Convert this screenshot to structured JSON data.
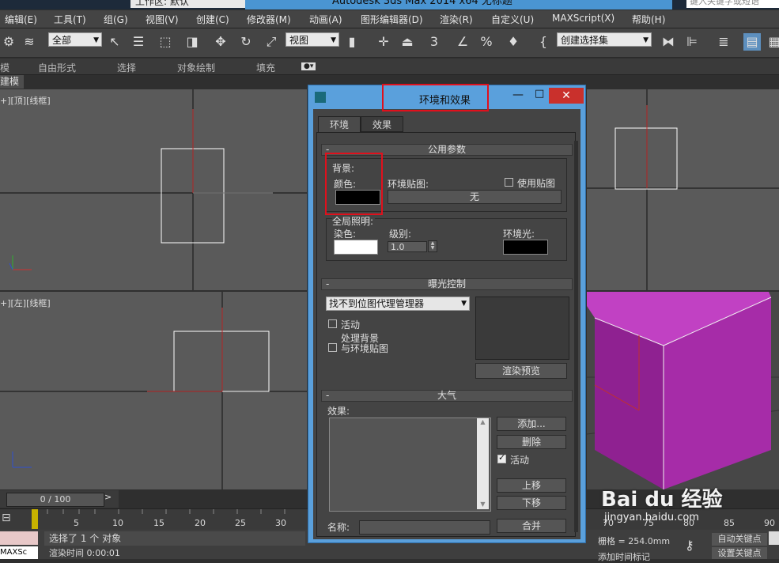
{
  "window": {
    "workspace": "工作区: 默认",
    "title": "Autodesk 3ds Max  2014 x64      无标题",
    "search_placeholder": "键入关键字或短语"
  },
  "menubar": [
    "编辑(E)",
    "工具(T)",
    "组(G)",
    "视图(V)",
    "创建(C)",
    "修改器(M)",
    "动画(A)",
    "图形编辑器(D)",
    "渲染(R)",
    "自定义(U)",
    "MAXScript(X)",
    "帮助(H)"
  ],
  "toolbar": {
    "selection_filter": "全部",
    "ref_coord": "视图",
    "named_selection": "创建选择集",
    "snap_3": "3",
    "percent": "%"
  },
  "ribbon": {
    "tabs": [
      "模",
      "自由形式",
      "选择",
      "对象绘制",
      "填充"
    ],
    "sub": "建模"
  },
  "viewports": {
    "top_label": "+][顶][线框]",
    "left_label": "+][左][线框]"
  },
  "timeline": {
    "frame": "0 / 100",
    "ticks": [
      "5",
      "10",
      "15",
      "20",
      "25",
      "30",
      "70",
      "75",
      "80",
      "85",
      "90"
    ]
  },
  "status": {
    "selected": "选择了 1 个 对象",
    "render_time": "渲染时间 0:00:01",
    "maxscript": "MAXSc",
    "grid": "栅格 = 254.0mm",
    "auto_key": "自动关键点",
    "set_key": "设置关键点",
    "add_time_tag": "添加时间标记"
  },
  "dialog": {
    "title": "环境和效果",
    "tabs": [
      "环境",
      "效果"
    ],
    "common": {
      "header": "公用参数",
      "background_label": "背景:",
      "color_label": "颜色:",
      "env_map_label": "环境贴图:",
      "use_map_label": "使用贴图",
      "env_map_button": "无",
      "global_light_label": "全局照明:",
      "tint_label": "染色:",
      "level_label": "级别:",
      "level_value": "1.0",
      "ambient_label": "环境光:",
      "background_color": "#000000",
      "tint_color": "#ffffff",
      "ambient_color": "#000000"
    },
    "exposure": {
      "header": "曝光控制",
      "selected": "找不到位图代理管理器",
      "active_label": "活动",
      "process_bg_label1": "处理背景",
      "process_bg_label2": "与环境贴图",
      "render_preview": "渲染预览"
    },
    "atmosphere": {
      "header": "大气",
      "effects_label": "效果:",
      "add": "添加...",
      "delete": "删除",
      "active_label": "活动",
      "move_up": "上移",
      "move_down": "下移",
      "name_label": "名称:",
      "merge": "合并"
    }
  },
  "watermark": {
    "brand": "Bai du 经验",
    "url": "jingyan.baidu.com"
  },
  "colors": {
    "accent": "#e0101c",
    "dialog_frame": "#5aa0dc",
    "object": "#a62ca8"
  }
}
